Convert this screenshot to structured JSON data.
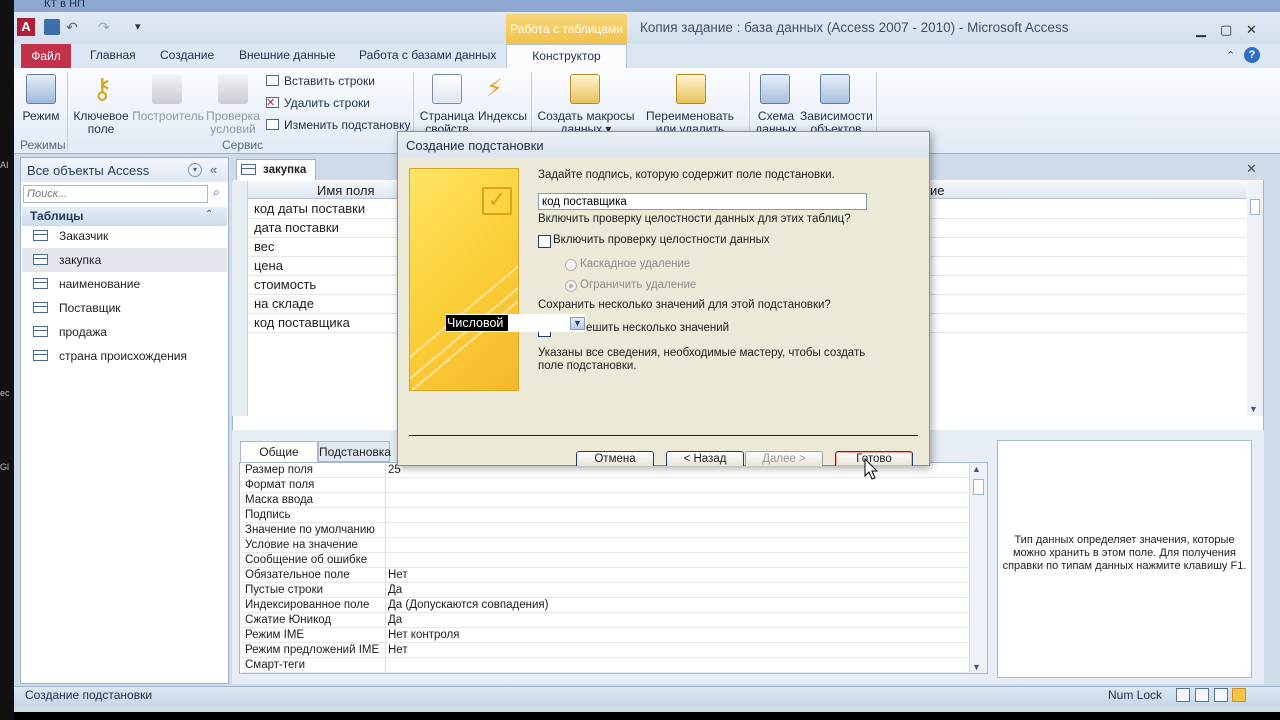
{
  "window": {
    "title": "Копия задание : база данных (Access 2007 - 2010)  -  Microsoft Access",
    "context_tab": "Работа с таблицами",
    "top_cut_label": "КТ в НП",
    "app_icon": "A"
  },
  "ribbon": {
    "file": "Файл",
    "tabs": [
      "Главная",
      "Создание",
      "Внешние данные",
      "Работа с базами данных"
    ],
    "active_tab": "Конструктор",
    "buttons": {
      "view": "Режим",
      "key": "Ключевое поле",
      "builder": "Построитель",
      "check_rules": "Проверка условий",
      "insert_rows": "Вставить строки",
      "delete_rows": "Удалить строки",
      "modify_lookup": "Изменить подстановку",
      "property_sheet": "Страница свойств",
      "indexes": "Индексы",
      "create_macros": "Создать макросы данных ▾",
      "rename_macro": "Переименовать или удалить макрос",
      "schema": "Схема данных",
      "dependencies": "Зависимости объектов"
    },
    "groups": {
      "views": "Режимы",
      "tools": "Сервис"
    }
  },
  "nav": {
    "title": "Все объекты Access",
    "search_placeholder": "Поиск...",
    "section": "Таблицы",
    "items": [
      "Заказчик",
      "закупка",
      "наименование",
      "Поставщик",
      "продажа",
      "страна происхождения"
    ]
  },
  "document": {
    "tab": "закупка",
    "col_field_name": "Имя поля",
    "col_desc_fragment": "ие",
    "fields": [
      "код даты поставки",
      "дата поставки",
      "вес",
      "цена",
      "стоимость",
      "на складе",
      "код поставщика"
    ],
    "datatype_value": "Числовой"
  },
  "properties": {
    "tabs": [
      "Общие",
      "Подстановка"
    ],
    "rows": [
      [
        "Размер поля",
        "25"
      ],
      [
        "Формат поля",
        ""
      ],
      [
        "Маска ввода",
        ""
      ],
      [
        "Подпись",
        ""
      ],
      [
        "Значение по умолчанию",
        ""
      ],
      [
        "Условие на значение",
        ""
      ],
      [
        "Сообщение об ошибке",
        ""
      ],
      [
        "Обязательное поле",
        "Нет"
      ],
      [
        "Пустые строки",
        "Да"
      ],
      [
        "Индексированное поле",
        "Да (Допускаются совпадения)"
      ],
      [
        "Сжатие Юникод",
        "Да"
      ],
      [
        "Режим IME",
        "Нет контроля"
      ],
      [
        "Режим предложений IME",
        "Нет"
      ],
      [
        "Смарт-теги",
        ""
      ]
    ],
    "help": "Тип данных определяет значения, которые можно хранить в этом поле. Для получения справки по типам данных нажмите клавишу F1."
  },
  "dialog": {
    "title": "Создание подстановки",
    "prompt_label": "Задайте подпись, которую содержит поле подстановки.",
    "label_value": "код поставщика",
    "integrity_question": "Включить проверку целостности данных для этих таблиц?",
    "integrity_checkbox": "Включить проверку целостности данных",
    "cascade_delete": "Каскадное удаление",
    "restrict_delete": "Ограничить удаление",
    "multi_question": "Сохранить несколько значений для этой подстановки?",
    "multi_checkbox": "Разрешить несколько значений",
    "multi_checkbox_visible": "ешить несколько значений",
    "info": "Указаны все сведения, необходимые мастеру, чтобы создать поле подстановки.",
    "buttons": {
      "cancel": "Отмена",
      "back": "< Назад",
      "next": "Далее >",
      "finish": "Готово"
    }
  },
  "status": {
    "left": "Создание подстановки",
    "num_lock": "Num Lock"
  },
  "colors": {
    "file_tab": "#c2324a",
    "context_tab": "#f2c24a",
    "wizard_art": "#fbd23b",
    "ribbon_bg": "#e2eaf5"
  },
  "icons": [
    "key-icon",
    "search-icon",
    "table-icon",
    "checkmark-icon",
    "chevron-down-icon",
    "mouse-cursor-icon"
  ]
}
